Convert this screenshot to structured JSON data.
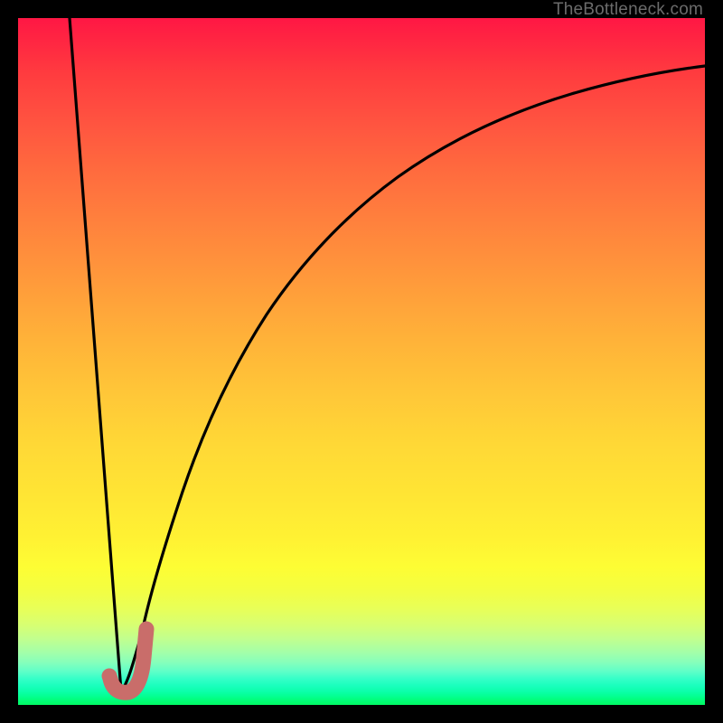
{
  "watermark": "TheBottleneck.com",
  "colors": {
    "background": "#000000",
    "curve": "#000000",
    "marker_stroke": "#c96d6a",
    "marker_fill": "none"
  },
  "chart_data": {
    "type": "line",
    "title": "",
    "xlabel": "",
    "ylabel": "",
    "xlim": [
      0,
      100
    ],
    "ylim": [
      0,
      100
    ],
    "grid": false,
    "legend": false,
    "series": [
      {
        "name": "left-branch",
        "x": [
          7.5,
          15.0
        ],
        "y": [
          100,
          2
        ]
      },
      {
        "name": "right-branch",
        "x": [
          15.0,
          16.0,
          17.0,
          18.0,
          19.0,
          20.0,
          22.0,
          24.0,
          26.0,
          28.0,
          30.0,
          33.0,
          36.0,
          40.0,
          45.0,
          50.0,
          56.0,
          63.0,
          70.0,
          78.0,
          86.0,
          93.0,
          100.0
        ],
        "y": [
          2.0,
          3.2,
          6.0,
          10.5,
          15.5,
          21.0,
          31.0,
          40.0,
          47.5,
          54.0,
          59.5,
          66.0,
          71.0,
          75.8,
          80.2,
          83.4,
          86.1,
          88.4,
          90.0,
          91.3,
          92.2,
          92.8,
          93.0
        ]
      }
    ],
    "annotations": [
      {
        "name": "j-dip-marker",
        "shape": "j-hook",
        "approx_x_range": [
          13.5,
          18.5
        ],
        "approx_y_range": [
          2,
          12
        ]
      }
    ]
  }
}
